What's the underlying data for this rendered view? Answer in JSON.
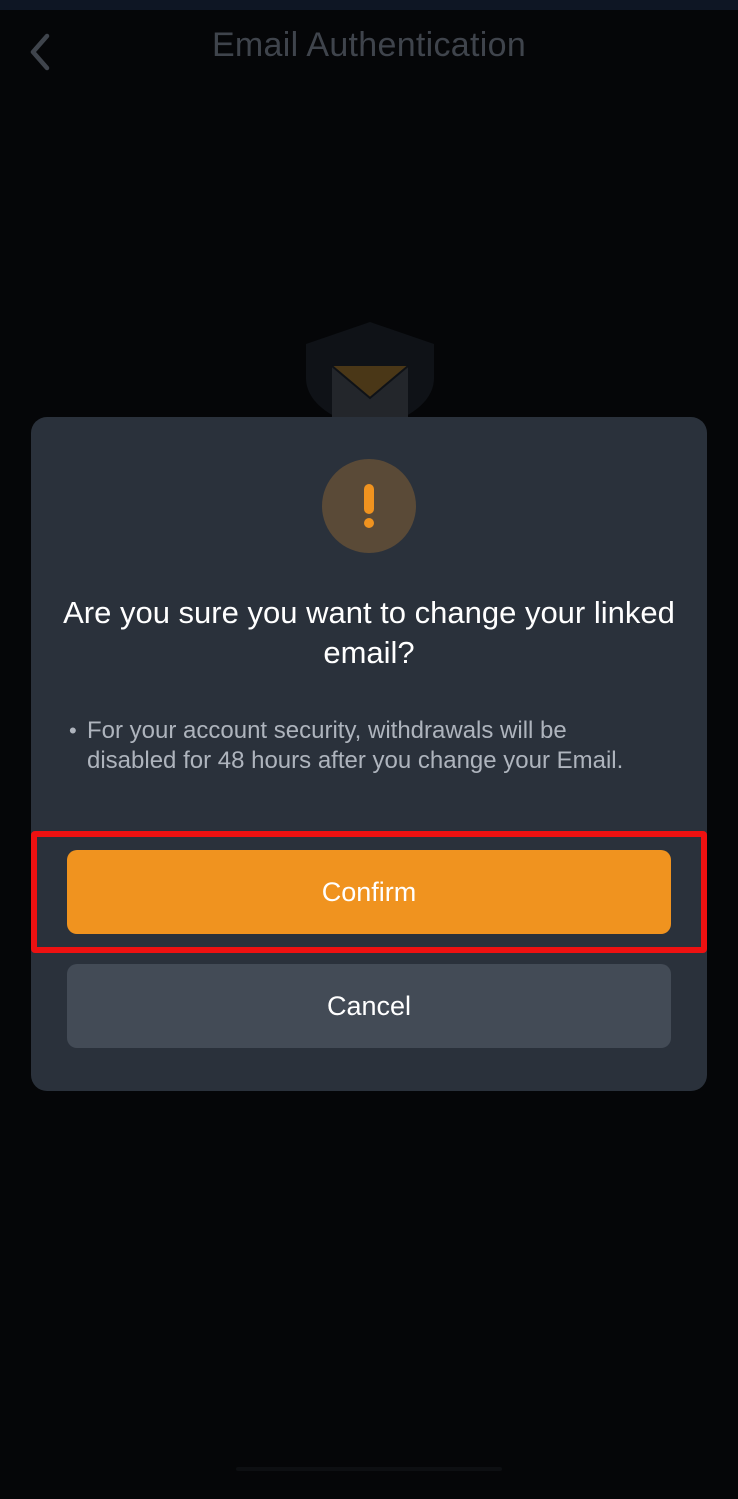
{
  "header": {
    "title": "Email Authentication",
    "back_icon": "chevron-left-icon"
  },
  "hero": {
    "icon": "shield-envelope-icon"
  },
  "dialog": {
    "icon": "exclamation-icon",
    "title": "Are you sure you want to change your linked email?",
    "notice": "For your account security, withdrawals will be disabled for 48 hours after you change your Email.",
    "confirm_label": "Confirm",
    "cancel_label": "Cancel"
  },
  "colors": {
    "accent": "#f0931f",
    "dialog_bg": "#2a313b",
    "highlight": "#ee1111"
  }
}
